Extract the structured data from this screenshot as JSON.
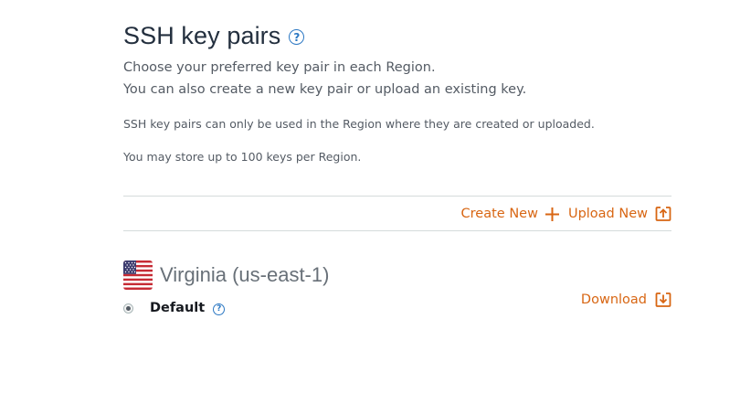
{
  "header": {
    "title": "SSH key pairs",
    "help_icon": "help-circle-icon"
  },
  "description": {
    "line1": "Choose your preferred key pair in each Region.",
    "line2": "You can also create a new key pair or upload an existing key."
  },
  "notes": {
    "region_note": "SSH key pairs can only be used in the Region where they are created or uploaded.",
    "limit_note": "You may store up to 100 keys per Region."
  },
  "actions": {
    "create_label": "Create New",
    "create_icon": "plus-icon",
    "upload_label": "Upload New",
    "upload_icon": "upload-arrow-icon"
  },
  "region": {
    "flag_icon": "us-flag-icon",
    "name": "Virginia (us-east-1)",
    "keys": [
      {
        "name": "Default",
        "selected": true,
        "help_icon": "help-circle-icon"
      }
    ],
    "download_label": "Download",
    "download_icon": "download-arrow-icon"
  },
  "colors": {
    "accent": "#d86613",
    "link_help": "#2c78c3",
    "title": "#232f3e",
    "text": "#545b64",
    "divider": "#d5dbdb"
  }
}
